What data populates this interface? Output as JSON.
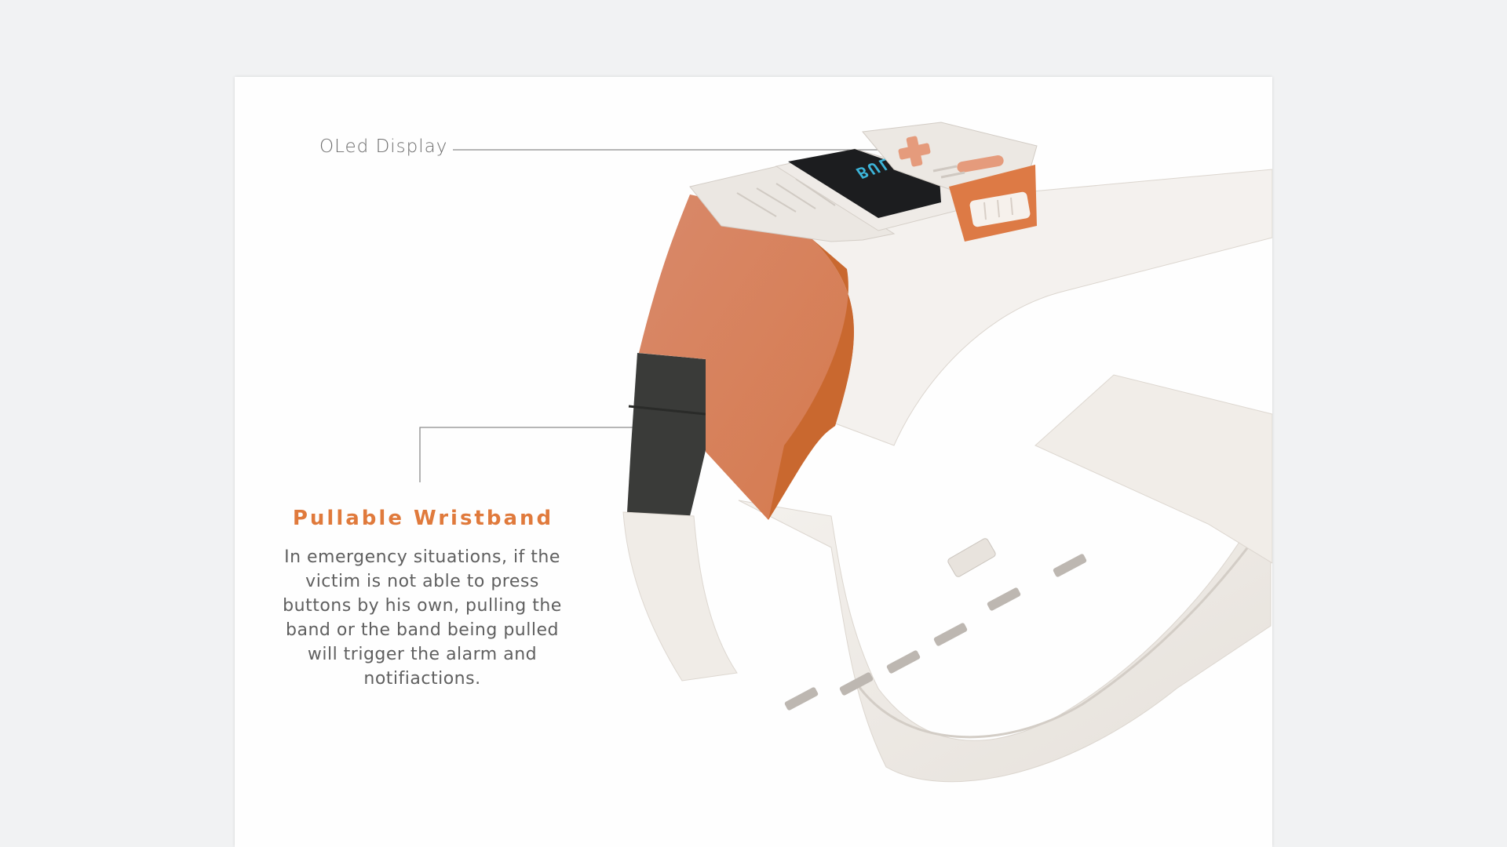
{
  "callouts": {
    "display_label": "OLed Display",
    "band_title": "Pullable Wristband",
    "band_description": "In emergency situations, if the victim is not able to press buttons by his own, pulling the band or the band being pulled will trigger the alarm and notifiactions."
  },
  "device": {
    "screen_text": "BULLAID"
  },
  "colors": {
    "accent": "#e07a3c",
    "band": "#efebe6",
    "screen_text": "#3cb4d8",
    "page": "#fefefe",
    "background": "#f1f2f3"
  }
}
